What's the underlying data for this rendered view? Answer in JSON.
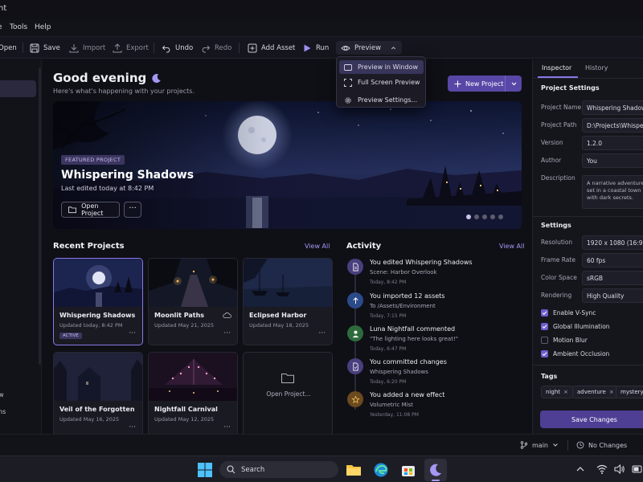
{
  "app": {
    "title_fragment": "ht"
  },
  "menu": [
    "Tools",
    "Help"
  ],
  "toolbar": {
    "open": "Open",
    "save": "Save",
    "import": "Import",
    "export": "Export",
    "undo": "Undo",
    "redo": "Redo",
    "add_asset": "Add Asset",
    "run": "Run",
    "preview": "Preview"
  },
  "preview_menu": {
    "items": [
      "Preview in Window",
      "Full Screen Preview",
      "Preview Settings..."
    ],
    "active_index": 0
  },
  "left_rail": {
    "fragments": [
      "w",
      "ns"
    ]
  },
  "home": {
    "greeting": "Good evening",
    "subtitle": "Here's what's happening with your projects.",
    "new_project": "New Project"
  },
  "featured": {
    "tag": "FEATURED PROJECT",
    "title": "Whispering Shadows",
    "edited": "Last edited today at 8:42 PM",
    "open_label": "Open Project",
    "more": "···",
    "slides": 5,
    "active_slide": 0
  },
  "recent": {
    "title": "Recent Projects",
    "view_all": "View All",
    "projects": [
      {
        "name": "Whispering Shadows",
        "updated": "Updated today, 8:42 PM",
        "badge": "ACTIVE",
        "more": "···"
      },
      {
        "name": "Moonlit Paths",
        "updated": "Updated May 21, 2025",
        "more": "···"
      },
      {
        "name": "Eclipsed Harbor",
        "updated": "Updated May 18, 2025",
        "more": "···"
      },
      {
        "name": "Veil of the Forgotten",
        "updated": "Updated May 16, 2025",
        "more": "···"
      },
      {
        "name": "Nightfall Carnival",
        "updated": "Updated May 12, 2025",
        "more": "···"
      }
    ],
    "open_card": "Open Project..."
  },
  "activity": {
    "title": "Activity",
    "view_all": "View All",
    "items": [
      {
        "icon": "file-icon",
        "color": "#4a3f7e",
        "title": "You edited Whispering Shadows",
        "detail": "Scene: Harbor Overlook",
        "time": "Today, 8:42 PM"
      },
      {
        "icon": "upload-icon",
        "color": "#2b4a8a",
        "title": "You imported 12 assets",
        "detail": "To /Assets/Environment",
        "time": "Today, 7:15 PM"
      },
      {
        "icon": "user-icon",
        "color": "#2d6b3c",
        "title": "Luna Nightfall commented",
        "detail": "\"The lighting here looks great!\"",
        "time": "Today, 6:47 PM"
      },
      {
        "icon": "commit-icon",
        "color": "#4a3f7e",
        "title": "You committed changes",
        "detail": "Whispering Shadows",
        "time": "Today, 6:20 PM"
      },
      {
        "icon": "star-icon",
        "color": "#6b4a1e",
        "title": "You added a new effect",
        "detail": "Volumetric Mist",
        "time": "Yesterday, 11:08 PM"
      }
    ]
  },
  "inspector": {
    "tabs": [
      "Inspector",
      "History"
    ],
    "project_settings_title": "Project Settings",
    "fields": [
      {
        "label": "Project Name",
        "value": "Whispering Shadows"
      },
      {
        "label": "Project Path",
        "value": "D:\\Projects\\Whispering"
      },
      {
        "label": "Version",
        "value": "1.2.0"
      },
      {
        "label": "Author",
        "value": "You"
      }
    ],
    "description_label": "Description",
    "description": "A narrative adventure set in a coastal town with dark secrets.",
    "settings_title": "Settings",
    "settings": [
      {
        "label": "Resolution",
        "value": "1920 x 1080 (16:9)"
      },
      {
        "label": "Frame Rate",
        "value": "60 fps"
      },
      {
        "label": "Color Space",
        "value": "sRGB"
      },
      {
        "label": "Rendering",
        "value": "High Quality"
      }
    ],
    "checkboxes": [
      {
        "label": "Enable V-Sync",
        "checked": true
      },
      {
        "label": "Global Illumination",
        "checked": true
      },
      {
        "label": "Motion Blur",
        "checked": false
      },
      {
        "label": "Ambient Occlusion",
        "checked": true
      }
    ],
    "tags_title": "Tags",
    "tags": [
      "night",
      "adventure",
      "mystery"
    ],
    "save": "Save Changes"
  },
  "status": {
    "branch": "main",
    "changes": "No Changes"
  },
  "taskbar": {
    "search": "Search"
  }
}
